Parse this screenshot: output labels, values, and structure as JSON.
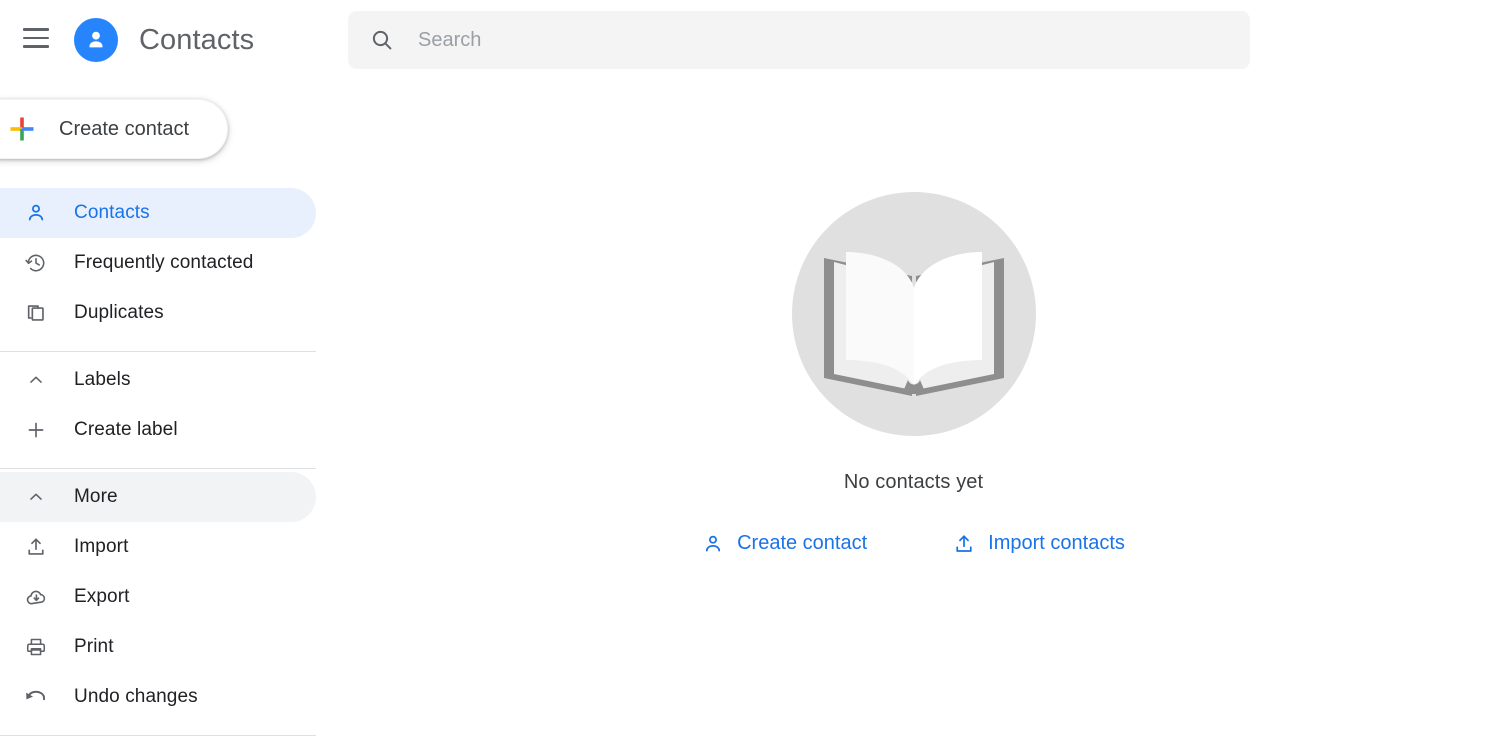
{
  "header": {
    "menu_icon": "hamburger-menu-icon",
    "avatar_icon": "person-avatar-icon",
    "title": "Contacts"
  },
  "search": {
    "icon": "search-icon",
    "placeholder": "Search",
    "value": ""
  },
  "sidebar": {
    "create_button": {
      "label": "Create contact",
      "icon": "google-plus-icon"
    },
    "groups": [
      {
        "items": [
          {
            "label": "Contacts",
            "icon": "person-icon",
            "state": "active"
          },
          {
            "label": "Frequently contacted",
            "icon": "history-icon",
            "state": "normal"
          },
          {
            "label": "Duplicates",
            "icon": "copy-icon",
            "state": "normal"
          }
        ]
      },
      {
        "items": [
          {
            "label": "Labels",
            "icon": "chevron-up-icon",
            "state": "normal"
          },
          {
            "label": "Create label",
            "icon": "plus-icon",
            "state": "normal"
          }
        ]
      },
      {
        "items": [
          {
            "label": "More",
            "icon": "chevron-up-icon",
            "state": "hovered"
          },
          {
            "label": "Import",
            "icon": "upload-icon",
            "state": "normal"
          },
          {
            "label": "Export",
            "icon": "cloud-download-icon",
            "state": "normal"
          },
          {
            "label": "Print",
            "icon": "printer-icon",
            "state": "normal"
          },
          {
            "label": "Undo changes",
            "icon": "undo-icon",
            "state": "normal"
          }
        ]
      }
    ]
  },
  "main": {
    "illustration": "open-book-illustration",
    "title": "No contacts yet",
    "actions": [
      {
        "label": "Create contact",
        "icon": "person-add-icon"
      },
      {
        "label": "Import contacts",
        "icon": "upload-icon"
      }
    ]
  },
  "colors": {
    "accent_blue": "#1a73e8",
    "avatar_blue": "#2684fc",
    "active_pill": "#e8f0fe",
    "hover_pill": "#f1f3f4",
    "search_bg": "#f4f4f4",
    "icon_gray": "#5f6368",
    "text_primary": "#202124",
    "text_secondary": "#3c4043",
    "placeholder": "#9aa0a6",
    "divider": "#e0e0e0",
    "illustration_circle": "#e0e0e0",
    "illustration_cover": "#8e8e8e",
    "google_red": "#ea4335",
    "google_yellow": "#fbbc04",
    "google_green": "#34a853",
    "google_blue": "#4285f4"
  }
}
